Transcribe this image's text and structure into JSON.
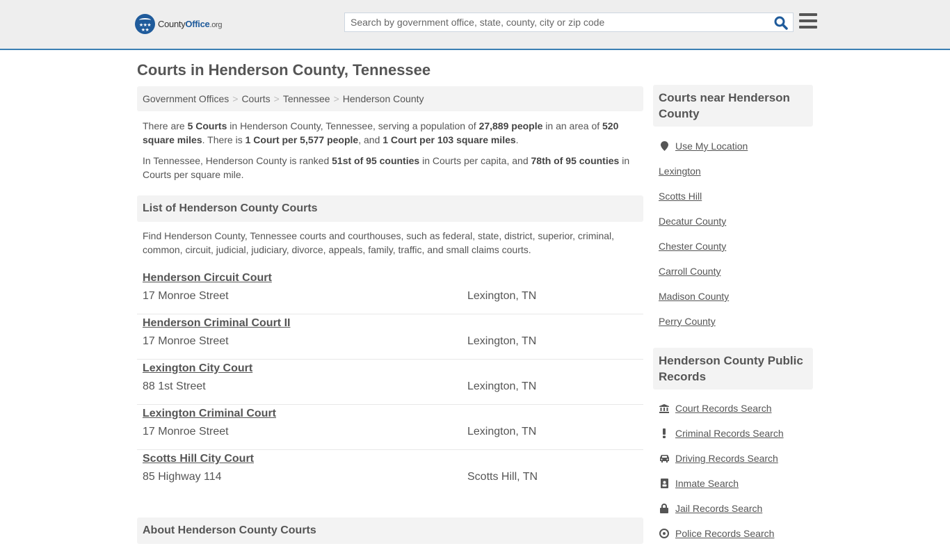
{
  "header": {
    "logo": {
      "county": "County",
      "office": "Office",
      "org": ".org"
    },
    "search_placeholder": "Search by government office, state, county, city or zip code",
    "colors": {
      "brand_blue": "#1f5b9b",
      "header_border": "#3b7fb3",
      "header_bg": "#eeeeee"
    }
  },
  "page_title": "Courts in Henderson County, Tennessee",
  "breadcrumb": [
    {
      "label": "Government Offices"
    },
    {
      "label": "Courts"
    },
    {
      "label": "Tennessee"
    },
    {
      "label": "Henderson County"
    }
  ],
  "summary": {
    "p1": [
      {
        "t": "There are ",
        "b": false
      },
      {
        "t": "5 Courts",
        "b": true
      },
      {
        "t": " in Henderson County, Tennessee, serving a population of ",
        "b": false
      },
      {
        "t": "27,889 people",
        "b": true
      },
      {
        "t": " in an area of ",
        "b": false
      },
      {
        "t": "520 square miles",
        "b": true
      },
      {
        "t": ". There is ",
        "b": false
      },
      {
        "t": "1 Court per 5,577 people",
        "b": true
      },
      {
        "t": ", and ",
        "b": false
      },
      {
        "t": "1 Court per 103 square miles",
        "b": true
      },
      {
        "t": ".",
        "b": false
      }
    ],
    "p2": [
      {
        "t": "In Tennessee, Henderson County is ranked ",
        "b": false
      },
      {
        "t": "51st of 95 counties",
        "b": true
      },
      {
        "t": " in Courts per capita, and ",
        "b": false
      },
      {
        "t": "78th of 95 counties",
        "b": true
      },
      {
        "t": " in Courts per square mile.",
        "b": false
      }
    ]
  },
  "list_section": {
    "title": "List of Henderson County Courts",
    "intro": "Find Henderson County, Tennessee courts and courthouses, such as federal, state, district, superior, criminal, common, circuit, judicial, judiciary, divorce, appeals, family, traffic, and small claims courts."
  },
  "courts": [
    {
      "name": "Henderson Circuit Court",
      "address": "17 Monroe Street",
      "city": "Lexington, TN"
    },
    {
      "name": "Henderson Criminal Court II",
      "address": "17 Monroe Street",
      "city": "Lexington, TN"
    },
    {
      "name": "Lexington City Court",
      "address": "88 1st Street",
      "city": "Lexington, TN"
    },
    {
      "name": "Lexington Criminal Court",
      "address": "17 Monroe Street",
      "city": "Lexington, TN"
    },
    {
      "name": "Scotts Hill City Court",
      "address": "85 Highway 114",
      "city": "Scotts Hill, TN"
    }
  ],
  "about_section": {
    "title": "About Henderson County Courts"
  },
  "sidebar": {
    "nearby_title": "Courts near Henderson County",
    "use_location": "Use My Location",
    "nearby": [
      "Lexington",
      "Scotts Hill",
      "Decatur County",
      "Chester County",
      "Carroll County",
      "Madison County",
      "Perry County"
    ],
    "records_title": "Henderson County Public Records",
    "records": [
      {
        "label": "Court Records Search",
        "icon": "bank-icon"
      },
      {
        "label": "Criminal Records Search",
        "icon": "exclamation-icon"
      },
      {
        "label": "Driving Records Search",
        "icon": "car-icon"
      },
      {
        "label": "Inmate Search",
        "icon": "id-badge-icon"
      },
      {
        "label": "Jail Records Search",
        "icon": "lock-icon"
      },
      {
        "label": "Police Records Search",
        "icon": "police-badge-icon"
      }
    ]
  }
}
